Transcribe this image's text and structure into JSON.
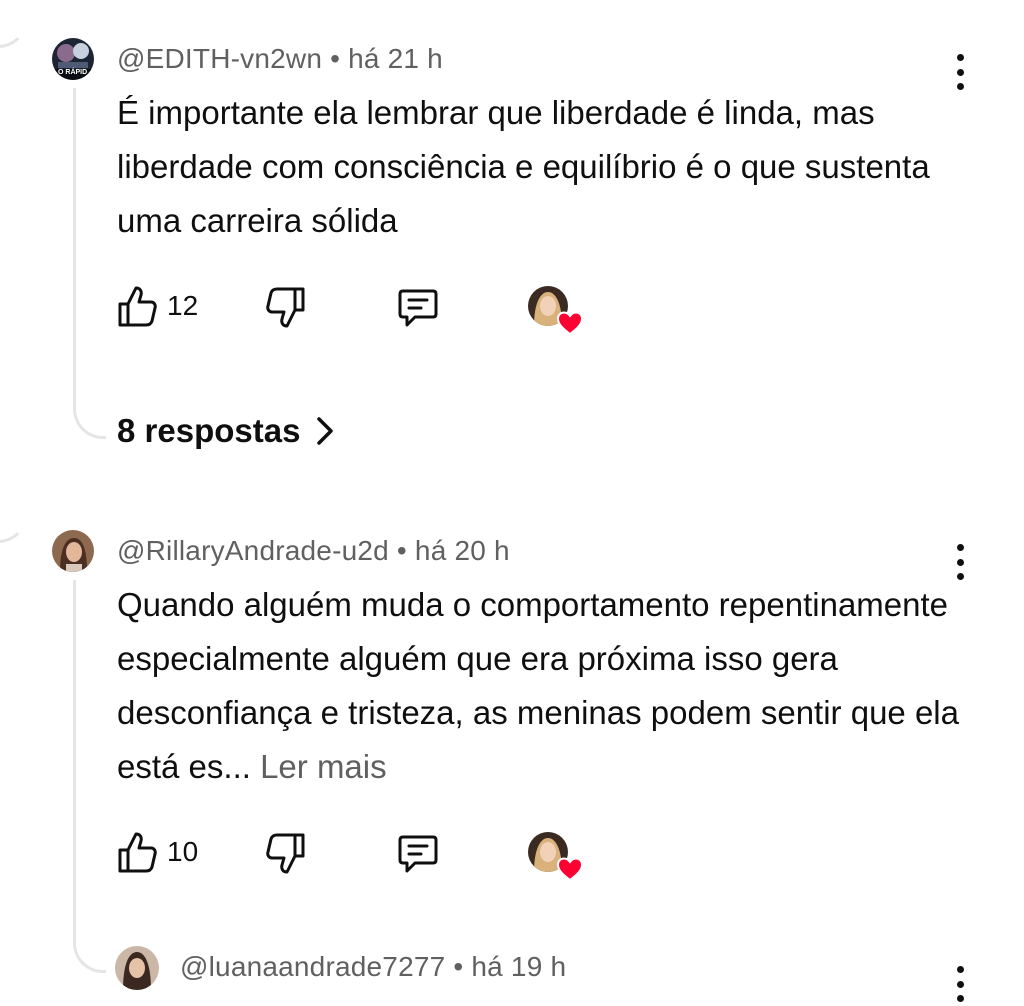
{
  "comments": [
    {
      "author": "@EDITH-vn2wn",
      "separator": "•",
      "time": "há 21 h",
      "avatar_caption": "O RÁPID",
      "text": "É importante ela lembrar que liberdade é linda, mas liberdade com consciência e equilíbrio é o que sustenta uma carreira sólida",
      "likes": "12",
      "replies_label": "8 respostas"
    },
    {
      "author": "@RillaryAndrade-u2d",
      "separator": "•",
      "time": "há 20 h",
      "text": "Quando alguém muda o comportamento repentinamente especialmente alguém que era próxima isso gera desconfiança e tristeza, as meninas podem sentir que ela está es...",
      "more_label": "Ler mais",
      "likes": "10"
    }
  ],
  "reply_preview": {
    "author": "@luanaandrade7277",
    "separator": "•",
    "time": "há 19 h"
  },
  "icons": {
    "like": "thumbs-up-icon",
    "dislike": "thumbs-down-icon",
    "reply": "comment-icon",
    "menu": "more-vertical-icon",
    "creator_heart": "heart-icon",
    "replies_arrow": "chevron-right-icon"
  },
  "colors": {
    "text": "#0f0f0f",
    "secondary": "#606060",
    "thread_line": "#e5e5e5",
    "heart": "#ff0033"
  }
}
